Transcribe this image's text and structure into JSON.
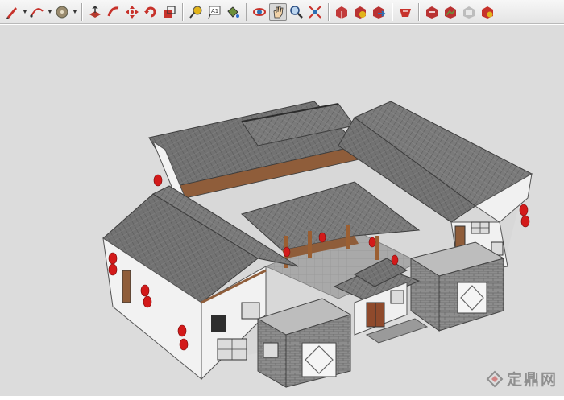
{
  "toolbar": {
    "tools": [
      {
        "name": "pencil-tool-icon",
        "has_menu": true
      },
      {
        "name": "arc-tool-icon",
        "has_menu": true
      },
      {
        "name": "circle-tool-icon",
        "has_menu": true
      },
      {
        "name": "push-pull-tool-icon"
      },
      {
        "name": "follow-me-tool-icon"
      },
      {
        "name": "move-tool-icon"
      },
      {
        "name": "rotate-tool-icon"
      },
      {
        "name": "scale-tool-icon"
      },
      {
        "name": "tape-measure-tool-icon"
      },
      {
        "name": "text-tool-icon"
      },
      {
        "name": "paint-bucket-tool-icon"
      },
      {
        "name": "orbit-tool-icon"
      },
      {
        "name": "pan-tool-icon",
        "active": true
      },
      {
        "name": "zoom-tool-icon"
      },
      {
        "name": "zoom-extents-tool-icon"
      },
      {
        "name": "3d-warehouse-icon"
      },
      {
        "name": "get-models-icon"
      },
      {
        "name": "share-model-icon"
      },
      {
        "name": "extension-warehouse-icon"
      },
      {
        "name": "component-tool-icon"
      },
      {
        "name": "add-location-icon"
      },
      {
        "name": "toggle-terrain-icon"
      },
      {
        "name": "photo-textures-icon"
      }
    ]
  },
  "watermark": {
    "text": "定鼎网"
  },
  "colors": {
    "canvas": "#dcdcdc",
    "roof": "#6f6f6f",
    "wall": "#f2f2f2",
    "brick": "#8a8a8a",
    "lantern": "#d31a1a"
  }
}
